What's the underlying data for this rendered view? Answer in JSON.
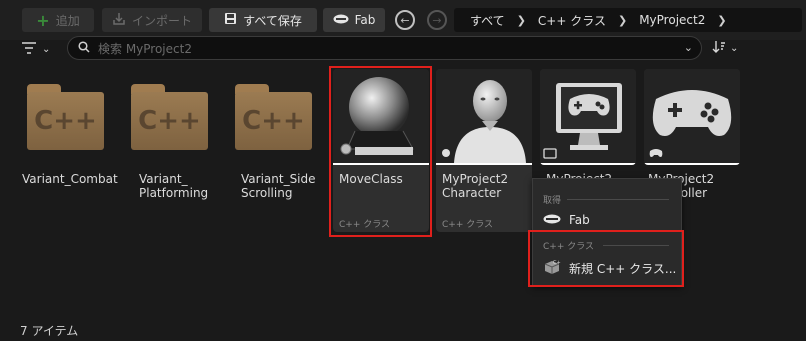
{
  "toolbar": {
    "add_label": "追加",
    "import_label": "インポート",
    "save_all_label": "すべて保存",
    "fab_label": "Fab"
  },
  "breadcrumb": {
    "items": [
      "すべて",
      "C++ クラス",
      "MyProject2"
    ]
  },
  "search": {
    "placeholder": "検索 MyProject2"
  },
  "folders": [
    {
      "label": "Variant_Combat"
    },
    {
      "label": "Variant_\nPlatforming"
    },
    {
      "label": "Variant_Side\nScrolling"
    }
  ],
  "classes": [
    {
      "name": "MoveClass",
      "type": "C++ クラス"
    },
    {
      "name": "MyProject2\nCharacter",
      "type": "C++ クラス"
    },
    {
      "name": "MyProject2",
      "type": ""
    },
    {
      "name": "MyProject2\nController",
      "type": ""
    }
  ],
  "context_menu": {
    "section_get": "取得",
    "fab_item": "Fab",
    "section_cpp": "C++ クラス",
    "new_cpp_item": "新規 C++ クラス..."
  },
  "status": {
    "item_count": "7 アイテム"
  },
  "colors": {
    "highlight_red": "#e0201c",
    "folder_brown": "#9b7b52",
    "background": "#1a1a1a"
  }
}
